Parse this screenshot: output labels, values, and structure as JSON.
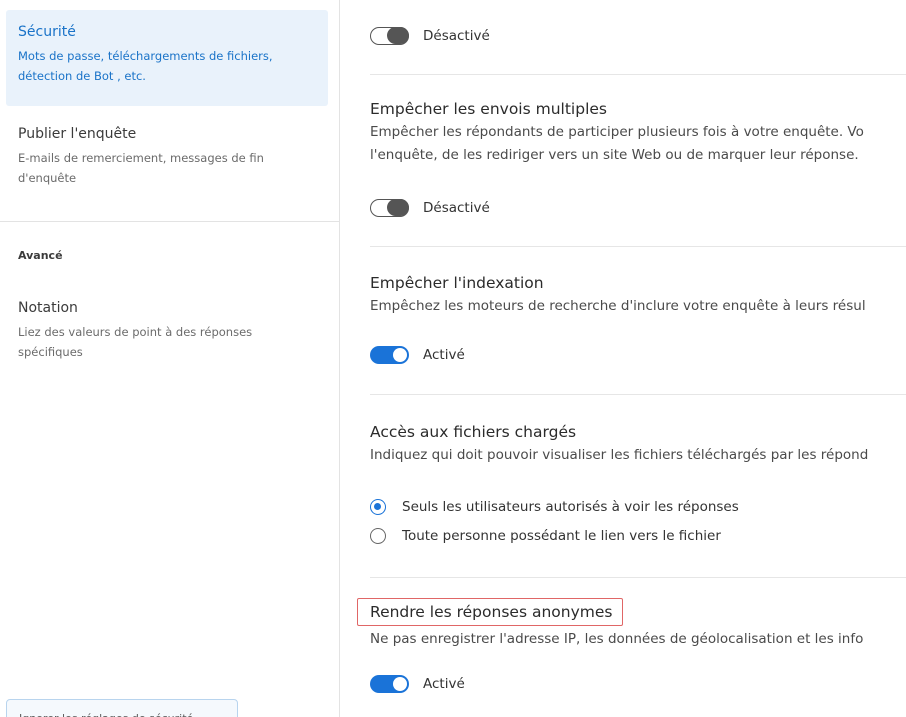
{
  "sidebar": {
    "items": [
      {
        "title": "Sécurité",
        "desc_line1": "Mots de passe, téléchargements de fichiers,",
        "desc_line2": "détection de Bot , etc."
      },
      {
        "title": "Publier l'enquête",
        "desc_line1": "E-mails de remerciement, messages de fin",
        "desc_line2": "d'enquête"
      },
      {
        "title": "Notation",
        "desc_line1": "Liez des valeurs de point à des réponses",
        "desc_line2": "spécifiques"
      }
    ],
    "section_advanced": "Avancé",
    "bottom_card_text": "Ignorer les réglages de sécurité"
  },
  "main": {
    "top_toggle": {
      "state_label": "Désactivé",
      "on": false
    },
    "multiple_submissions": {
      "title": "Empêcher les envois multiples",
      "desc_line1": "Empêcher les répondants de participer plusieurs fois à votre enquête. Vo",
      "desc_line2": "l'enquête, de les rediriger vers un site Web ou de marquer leur réponse.",
      "state_label": "Désactivé",
      "on": false
    },
    "indexing": {
      "title": "Empêcher l'indexation",
      "desc": "Empêchez les moteurs de recherche d'inclure votre enquête à leurs résul",
      "state_label": "Activé",
      "on": true
    },
    "file_access": {
      "title": "Accès aux fichiers chargés",
      "desc": "Indiquez qui doit pouvoir visualiser les fichiers téléchargés par les répond",
      "options": [
        {
          "label": "Seuls les utilisateurs autorisés à voir les réponses",
          "selected": true
        },
        {
          "label": "Toute personne possédant le lien vers le fichier",
          "selected": false
        }
      ]
    },
    "anonymize": {
      "title": "Rendre les réponses anonymes",
      "desc": "Ne pas enregistrer l'adresse IP, les données de géolocalisation et les info",
      "state_label": "Activé",
      "on": true
    }
  },
  "colors": {
    "accent": "#1a73d8",
    "active_bg": "#e9f2fb",
    "highlight_outline": "#e06666"
  }
}
